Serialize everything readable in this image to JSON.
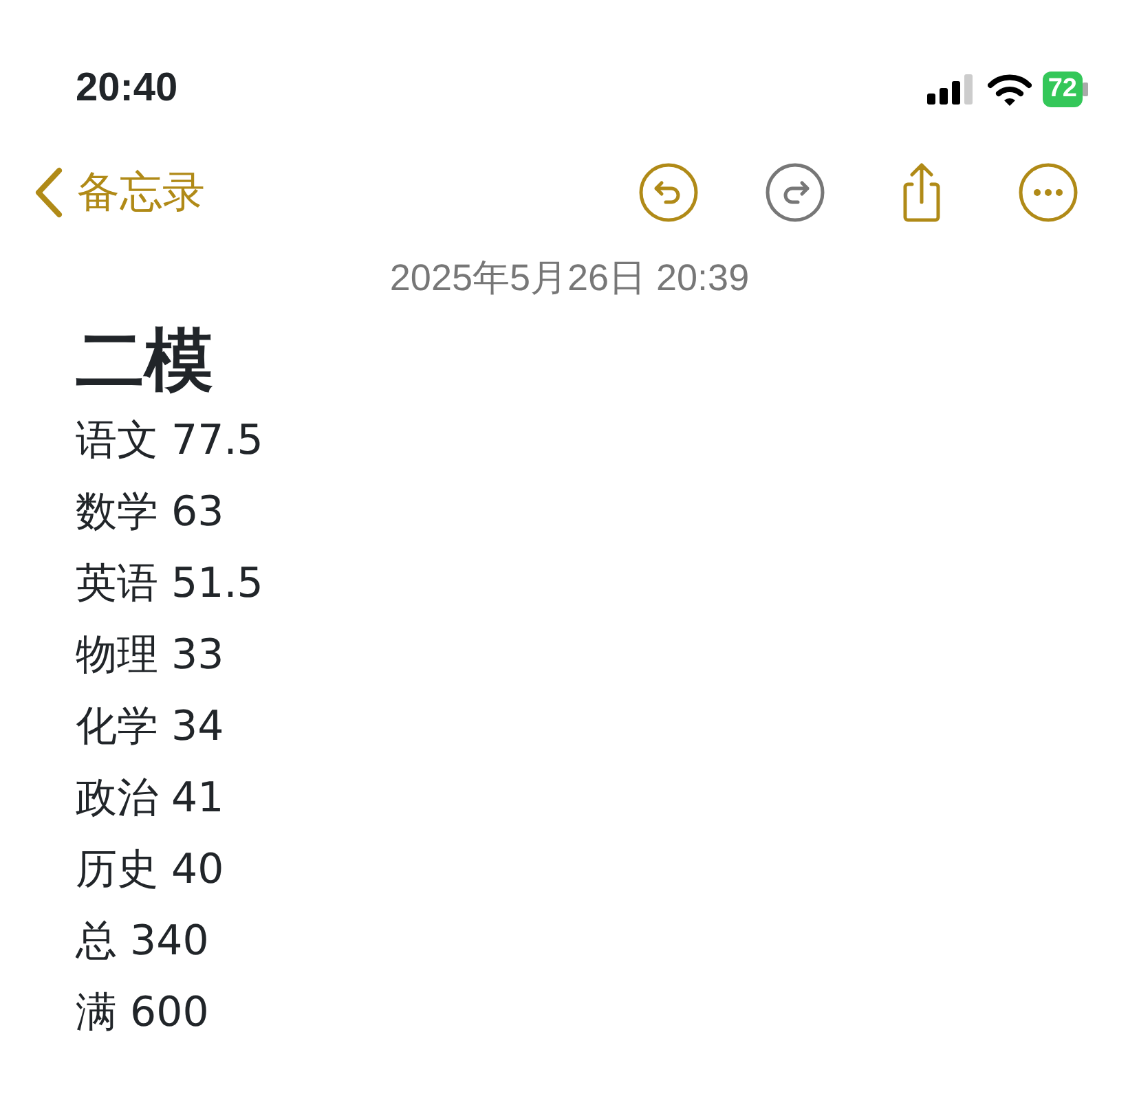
{
  "status_bar": {
    "time": "20:40",
    "battery": "72"
  },
  "nav": {
    "back_label": "备忘录",
    "buttons": [
      {
        "kind": "undo",
        "disabled": false
      },
      {
        "kind": "redo",
        "disabled": true
      },
      {
        "kind": "share",
        "disabled": false
      },
      {
        "kind": "more",
        "disabled": false
      }
    ]
  },
  "note": {
    "date": "2025年5月26日 20:39",
    "title": "二模",
    "lines": [
      "语文 77.5",
      "数学 63",
      "英语 51.5",
      "物理 33",
      "化学 34",
      "政治 41",
      "历史 40",
      "总 340",
      "满 600"
    ]
  }
}
